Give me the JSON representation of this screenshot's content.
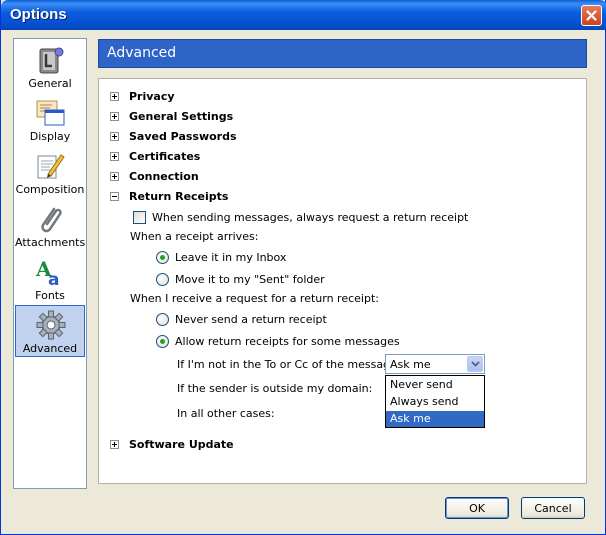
{
  "window": {
    "title": "Options"
  },
  "sidebar": {
    "items": [
      {
        "label": "General",
        "icon": "general-icon"
      },
      {
        "label": "Display",
        "icon": "display-icon"
      },
      {
        "label": "Composition",
        "icon": "composition-icon"
      },
      {
        "label": "Attachments",
        "icon": "attachments-icon"
      },
      {
        "label": "Fonts",
        "icon": "fonts-icon"
      },
      {
        "label": "Advanced",
        "icon": "advanced-icon",
        "selected": true
      }
    ]
  },
  "header": {
    "title": "Advanced"
  },
  "tree": {
    "privacy": "Privacy",
    "general_settings": "General Settings",
    "saved_passwords": "Saved Passwords",
    "certificates": "Certificates",
    "connection": "Connection",
    "return_receipts": "Return Receipts",
    "software_update": "Software Update"
  },
  "receipts": {
    "always_request": "When sending messages, always request a return receipt",
    "when_arrives": "When a receipt arrives:",
    "leave_inbox": "Leave it in my Inbox",
    "move_sent": "Move it to my \"Sent\" folder",
    "when_request": "When I receive a request for a return receipt:",
    "never_send": "Never send a return receipt",
    "allow_some": "Allow return receipts for some messages",
    "not_in_to_cc": "If I'm not in the To or Cc of the message:",
    "outside_domain": "If the sender is outside my domain:",
    "all_other": "In all other cases:",
    "select_value": "Ask me",
    "options": [
      "Never send",
      "Always send",
      "Ask me"
    ]
  },
  "buttons": {
    "ok": "OK",
    "cancel": "Cancel"
  },
  "colors": {
    "accent": "#2e63c8",
    "selection": "#316ac5",
    "radio_dot": "#21a121"
  }
}
